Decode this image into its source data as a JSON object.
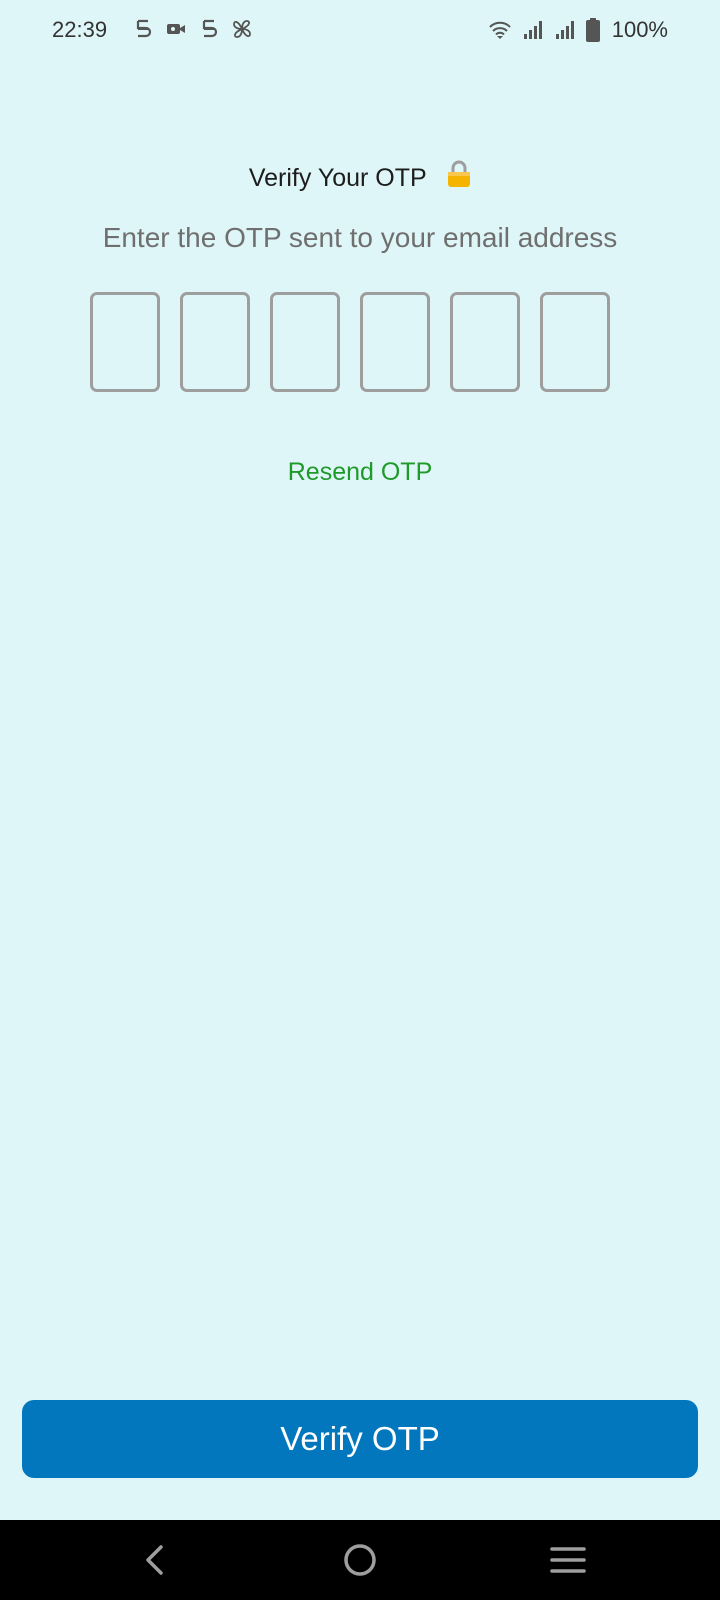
{
  "status_bar": {
    "time": "22:39",
    "battery_pct": "100%",
    "left_icons": [
      "sim-icon",
      "video-icon",
      "sim-icon",
      "pinwheel-icon"
    ],
    "right_icons": [
      "wifi-icon",
      "signal-icon",
      "signal-icon",
      "battery-icon"
    ]
  },
  "header": {
    "title": "Verify Your OTP",
    "lock_glyph": "🔒",
    "subtitle": "Enter the OTP sent to your email address"
  },
  "otp": {
    "digits": [
      "",
      "",
      "",
      "",
      "",
      ""
    ]
  },
  "resend_label": "Resend OTP",
  "verify_button_label": "Verify OTP",
  "colors": {
    "background": "#dff6f8",
    "accent": "#0277bd",
    "resend": "#1f9a2a",
    "box_border": "#9e9e9e"
  },
  "nav": {
    "icons": [
      "back-icon",
      "home-icon",
      "menu-icon"
    ]
  }
}
